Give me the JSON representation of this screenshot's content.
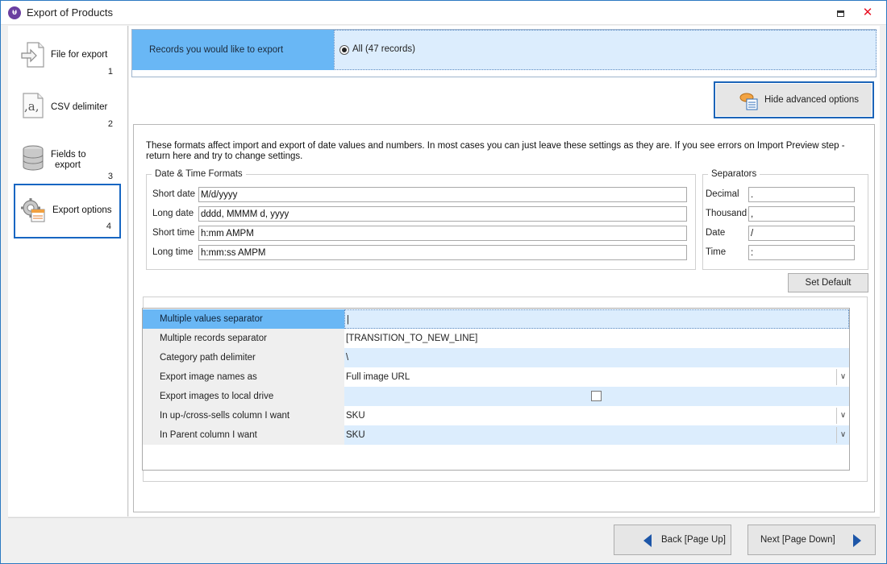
{
  "window": {
    "title": "Export of Products"
  },
  "steps": [
    {
      "label": "File for export",
      "number": "1",
      "icon": "file-export-icon"
    },
    {
      "label": "CSV delimiter",
      "number": "2",
      "icon": "csv-delimiter-icon"
    },
    {
      "label": "Fields to export",
      "label_line1": "Fields to",
      "label_line2": "export",
      "number": "3",
      "icon": "database-icon"
    },
    {
      "label": "Export options",
      "number": "4",
      "icon": "gear-options-icon",
      "active": true
    }
  ],
  "records": {
    "label": "Records you would like to export",
    "option": "All (47 records)"
  },
  "advanced_button": "Hide advanced options",
  "info_text": "These formats affect import and export of date values and numbers. In most cases you can just leave these settings as they are. If you see errors on Import Preview step - return here and try to change settings.",
  "date_time": {
    "legend": "Date & Time Formats",
    "fields": [
      {
        "label": "Short date",
        "value": "M/d/yyyy"
      },
      {
        "label": "Long date",
        "value": "dddd, MMMM d, yyyy"
      },
      {
        "label": "Short time",
        "value": "h:mm AMPM"
      },
      {
        "label": "Long time",
        "value": "h:mm:ss AMPM"
      }
    ]
  },
  "separators": {
    "legend": "Separators",
    "fields": [
      {
        "label": "Decimal",
        "value": "."
      },
      {
        "label": "Thousand",
        "value": ","
      },
      {
        "label": "Date",
        "value": "/"
      },
      {
        "label": "Time",
        "value": ":"
      }
    ]
  },
  "set_default": "Set Default",
  "advanced_grid": [
    {
      "key": "Multiple values separator",
      "value": "|"
    },
    {
      "key": "Multiple records separator",
      "value": "[TRANSITION_TO_NEW_LINE]"
    },
    {
      "key": "Category path delimiter",
      "value": "\\"
    },
    {
      "key": "Export image names as",
      "value": "Full image URL"
    },
    {
      "key": "Export images to local drive",
      "value": "",
      "checked": false
    },
    {
      "key": "In up-/cross-sells column I want",
      "value": "SKU"
    },
    {
      "key": "In Parent column I want",
      "value": "SKU"
    }
  ],
  "nav": {
    "back": "Back [Page Up]",
    "next": "Next [Page Down]"
  },
  "colors": {
    "accent": "#1766c2",
    "selected_label_bg": "#69b7f5",
    "value_bg": "#dcedfd",
    "nav_arrow": "#1d56a8"
  }
}
